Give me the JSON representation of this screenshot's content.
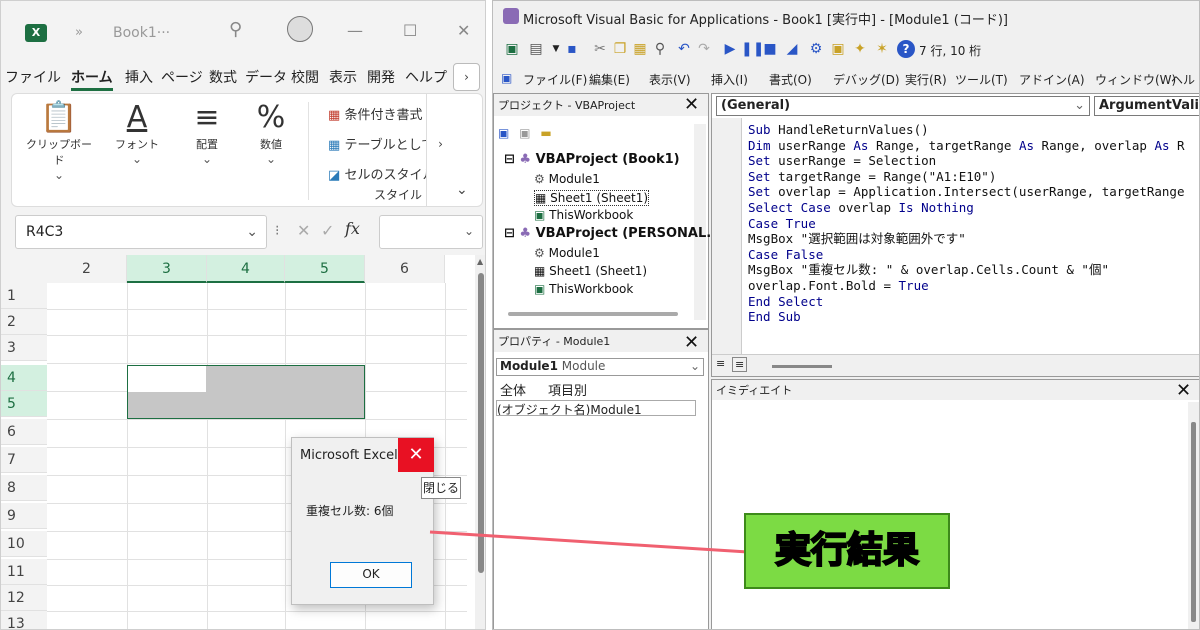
{
  "excel": {
    "logo": "X",
    "book_title": "Book1···",
    "menu": [
      "ファイル",
      "ホーム",
      "挿入",
      "ページ",
      "数式",
      "データ",
      "校閲",
      "表示",
      "開発",
      "ヘルプ"
    ],
    "ribbon": {
      "clipboard": "クリップボード",
      "font": "フォント",
      "align": "配置",
      "number": "数値",
      "cond_format": "条件付き書式",
      "table_format": "テーブルとして書",
      "cell_style": "セルのスタイル",
      "style_group": "スタイル"
    },
    "namebox": "R4C3",
    "columns": [
      "2",
      "3",
      "4",
      "5",
      "6"
    ],
    "rows": [
      "1",
      "2",
      "3",
      "4",
      "5",
      "6",
      "7",
      "8",
      "9",
      "10",
      "11",
      "12",
      "13"
    ]
  },
  "msgbox": {
    "title": "Microsoft Excel",
    "message": "重複セル数: 6個",
    "ok": "OK",
    "tooltip": "閉じる"
  },
  "vba": {
    "title": "Microsoft Visual Basic for Applications - Book1 [実行中] - [Module1 (コード)]",
    "toolbar_pos": "7 行, 10 桁",
    "menu": [
      "ファイル(F)",
      "編集(E)",
      "表示(V)",
      "挿入(I)",
      "書式(O)",
      "デバッグ(D)",
      "実行(R)",
      "ツール(T)",
      "アドイン(A)",
      "ウィンドウ(W)",
      "ヘル"
    ],
    "project_title": "プロジェクト - VBAProject",
    "project_tree": {
      "p1": "VBAProject (Book1)",
      "p1_mod": "Module1",
      "p1_sheet": "Sheet1 (Sheet1)",
      "p1_wb": "ThisWorkbook",
      "p2": "VBAProject (PERSONAL.",
      "p2_mod": "Module1",
      "p2_sheet": "Sheet1 (Sheet1)",
      "p2_wb": "ThisWorkbook"
    },
    "props_title": "プロパティ - Module1",
    "props_object": "Module1",
    "props_type": "Module",
    "props_tab_all": "全体",
    "props_tab_cat": "項目別",
    "props_name_key": "(オブジェクト名)",
    "props_name_val": "Module1",
    "combo_left": "(General)",
    "combo_right": "ArgumentVali",
    "code": [
      "Sub HandleReturnValues()",
      "Dim userRange As Range, targetRange As Range, overlap As R",
      "Set userRange = Selection",
      "Set targetRange = Range(\"A1:E10\")",
      "Set overlap = Application.Intersect(userRange, targetRange",
      "Select Case overlap Is Nothing",
      "Case True",
      "MsgBox \"選択範囲は対象範囲外です\"",
      "Case False",
      "MsgBox \"重複セル数: \" & overlap.Cells.Count & \"個\"",
      "overlap.Font.Bold = True",
      "End Select",
      "End Sub"
    ],
    "immediate_title": "イミディエイト"
  },
  "annotation": "実行結果",
  "colors": {
    "excel_green": "#1d6f42",
    "close_red": "#e81123",
    "label_green": "#7cdb44",
    "arrow_red": "#f06070"
  }
}
